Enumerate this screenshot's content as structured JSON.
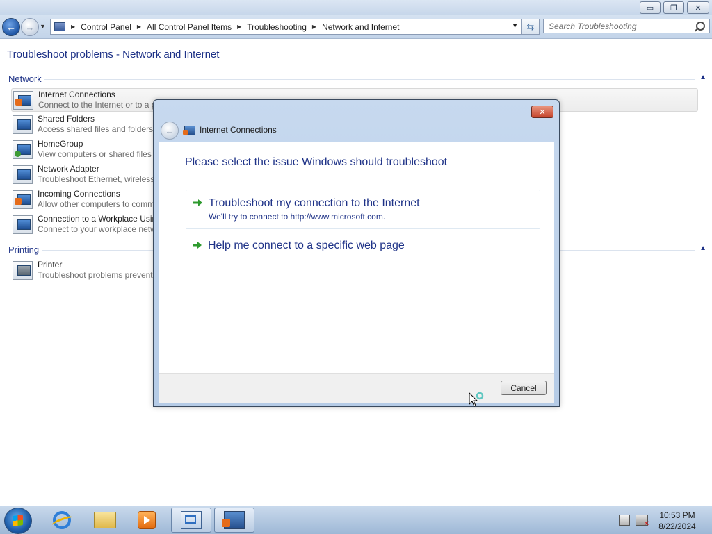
{
  "window": {
    "minimize_glyph": "▭",
    "maximize_glyph": "❐",
    "close_glyph": "✕"
  },
  "nav": {
    "breadcrumbs": [
      "Control Panel",
      "All Control Panel Items",
      "Troubleshooting",
      "Network and Internet"
    ],
    "search_placeholder": "Search Troubleshooting"
  },
  "page": {
    "title": "Troubleshoot problems - Network and Internet",
    "groups": [
      {
        "label": "Network",
        "items": [
          {
            "title": "Internet Connections",
            "description": "Connect to the Internet or to a p",
            "icon": "internet-connections-icon"
          },
          {
            "title": "Shared Folders",
            "description": "Access shared files and folders o",
            "icon": "shared-folders-icon"
          },
          {
            "title": "HomeGroup",
            "description": "View computers or shared files i",
            "icon": "homegroup-icon"
          },
          {
            "title": "Network Adapter",
            "description": "Troubleshoot Ethernet, wireless,",
            "icon": "network-adapter-icon"
          },
          {
            "title": "Incoming Connections",
            "description": "Allow other computers to comm",
            "icon": "incoming-connections-icon"
          },
          {
            "title": "Connection to a Workplace Usin",
            "description": "Connect to your workplace netw",
            "icon": "workplace-connection-icon"
          }
        ]
      },
      {
        "label": "Printing",
        "items": [
          {
            "title": "Printer",
            "description": "Troubleshoot problems prevent",
            "icon": "printer-icon"
          }
        ]
      }
    ]
  },
  "dialog": {
    "title": "Internet Connections",
    "heading": "Please select the issue Windows should troubleshoot",
    "options": [
      {
        "title": "Troubleshoot my connection to the Internet",
        "subtitle": "We'll try to connect to http://www.microsoft.com."
      },
      {
        "title": "Help me connect to a specific web page",
        "subtitle": ""
      }
    ],
    "cancel_label": "Cancel"
  },
  "taskbar": {
    "time": "10:53 PM",
    "date": "8/22/2024",
    "pinned": [
      "internet-explorer-icon",
      "windows-explorer-icon",
      "media-player-icon",
      "control-panel-icon",
      "internet-connections-icon"
    ]
  },
  "colors": {
    "link_blue": "#1e3287",
    "arrow_green": "#2e9a2e"
  }
}
